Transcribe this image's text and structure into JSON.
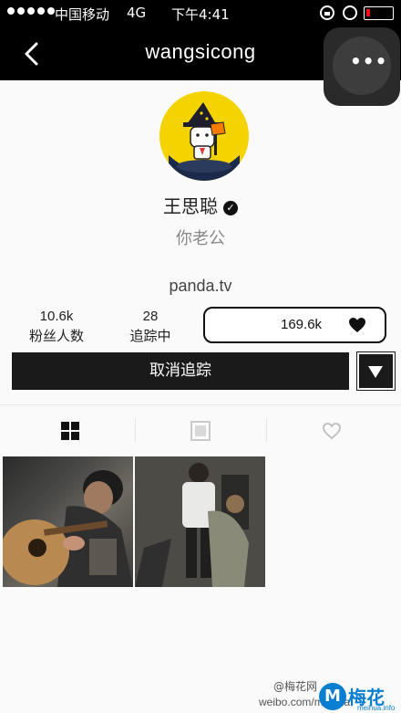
{
  "status_bar": {
    "carrier": "中国移动",
    "network": "4G",
    "time": "下午4:41",
    "signal_bars": 5,
    "battery_level": 0.1
  },
  "nav": {
    "title": "wangsicong",
    "more_label": "•••"
  },
  "profile": {
    "name": "王思聪",
    "verified_mark": "✓",
    "bio": "你老公",
    "website": "panda.tv"
  },
  "stats": {
    "followers_count": "10.6k",
    "followers_label": "粉丝人数",
    "following_count": "28",
    "following_label": "追踪中",
    "likes_count": "169.6k"
  },
  "actions": {
    "unfollow_label": "取消追踪"
  },
  "tabs": [
    {
      "icon": "grid-icon",
      "active": true
    },
    {
      "icon": "square-icon",
      "active": false
    },
    {
      "icon": "heart-outline-icon",
      "active": false
    }
  ],
  "colors": {
    "avatar_bg": "#f5d300",
    "accent_blue": "#0a7fd1"
  },
  "watermark": {
    "weibo_handle": "@梅花网",
    "weibo_url": "weibo.com/meihua",
    "site_name": "梅花网",
    "site_url": "meihua.info"
  }
}
